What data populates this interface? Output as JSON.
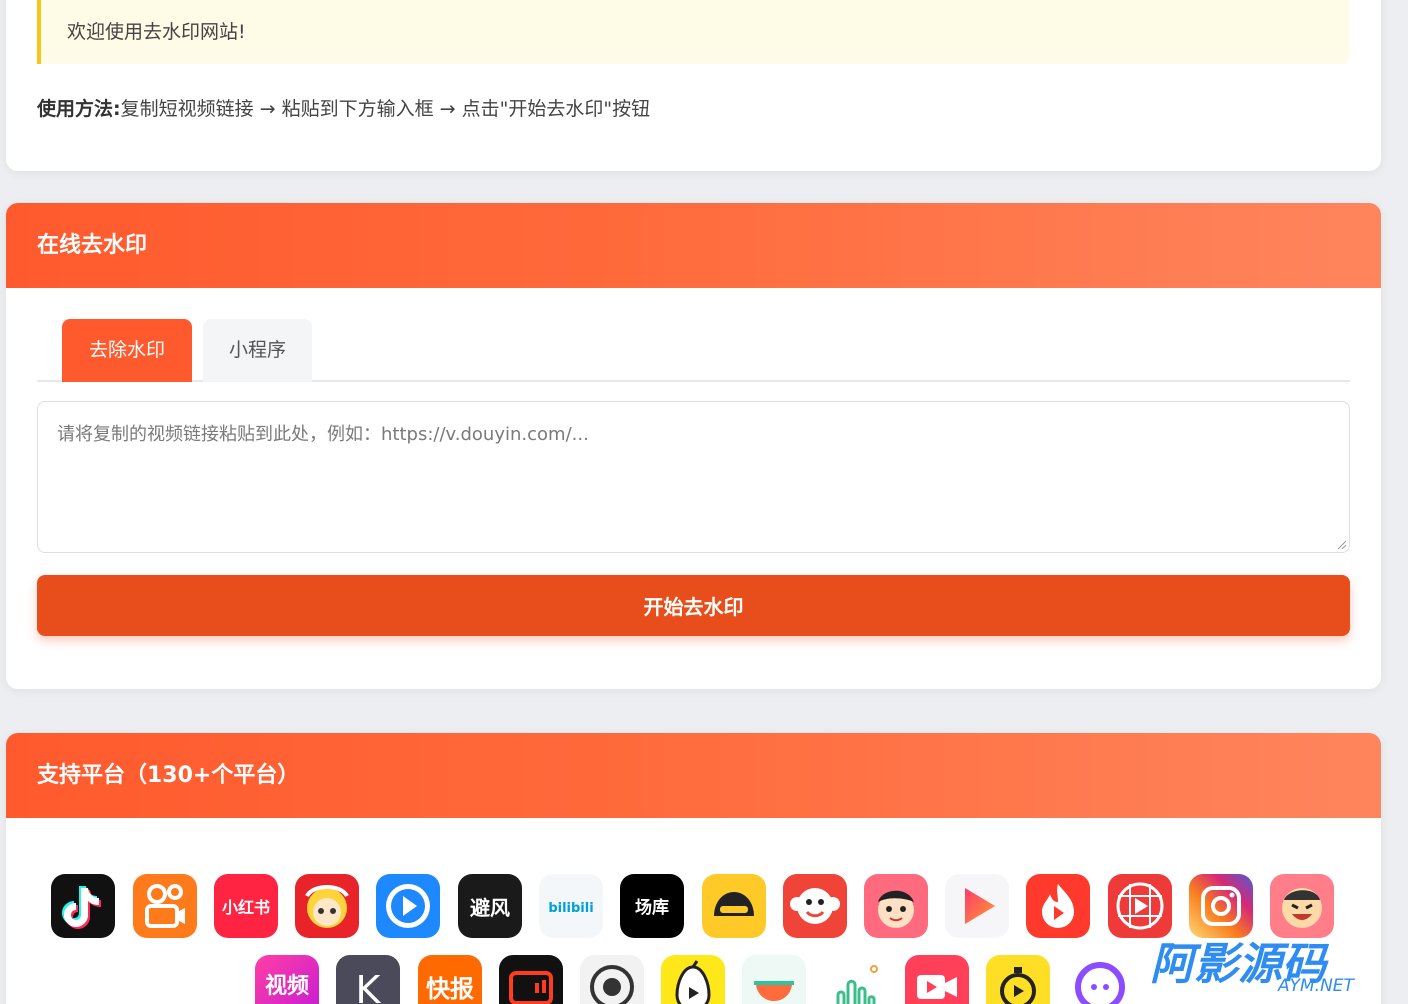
{
  "intro": {
    "welcome": "欢迎使用去水印网站!",
    "usage_label": "使用方法:",
    "usage_text": "复制短视频链接 → 粘贴到下方输入框 → 点击\"开始去水印\"按钮"
  },
  "tool": {
    "title": "在线去水印",
    "tabs": [
      {
        "label": "去除水印",
        "active": true
      },
      {
        "label": "小程序",
        "active": false
      }
    ],
    "input": {
      "value": "",
      "placeholder": "请将复制的视频链接粘贴到此处，例如：https://v.douyin.com/..."
    },
    "start_button": "开始去水印"
  },
  "platforms": {
    "title": "支持平台（130+个平台）",
    "row1": [
      {
        "icon": "douyin-icon",
        "text": ""
      },
      {
        "icon": "kuaishou-icon",
        "text": ""
      },
      {
        "icon": "xiaohongshu-icon",
        "text": "小红书"
      },
      {
        "icon": "anime-girl-icon",
        "text": ""
      },
      {
        "icon": "play-circle-icon",
        "text": ""
      },
      {
        "icon": "bifeng-icon",
        "text": "避风"
      },
      {
        "icon": "bilibili-icon",
        "text": "bilibili"
      },
      {
        "icon": "changku-icon",
        "text": "场库"
      },
      {
        "icon": "helmet-icon",
        "text": ""
      },
      {
        "icon": "monkey-icon",
        "text": ""
      },
      {
        "icon": "cartoon-face-icon",
        "text": ""
      },
      {
        "icon": "gradient-play-icon",
        "text": ""
      },
      {
        "icon": "flame-play-icon",
        "text": ""
      },
      {
        "icon": "grid-play-icon",
        "text": ""
      },
      {
        "icon": "instagram-icon",
        "text": ""
      },
      {
        "icon": "laughing-face-icon",
        "text": ""
      }
    ],
    "row2": [
      {
        "icon": "video-icon",
        "text": "视频"
      },
      {
        "icon": "k-icon",
        "text": "K"
      },
      {
        "icon": "kuaibao-icon",
        "text": "快报"
      },
      {
        "icon": "screen-icon",
        "text": ""
      },
      {
        "icon": "eye-icon",
        "text": ""
      },
      {
        "icon": "pear-icon",
        "text": ""
      },
      {
        "icon": "bowl-icon",
        "text": ""
      },
      {
        "icon": "oasis-icon",
        "text": ""
      },
      {
        "icon": "video-camera-icon",
        "text": ""
      },
      {
        "icon": "stopwatch-icon",
        "text": ""
      },
      {
        "icon": "chat-bubble-icon",
        "text": ""
      }
    ]
  },
  "watermark": {
    "main": "阿影源码",
    "sub": "AYM.NET"
  },
  "colors": {
    "brand": "#ff5a2e",
    "button": "#e84e1b",
    "notice_bg": "#fefbe6",
    "notice_bar": "#f5c518"
  }
}
